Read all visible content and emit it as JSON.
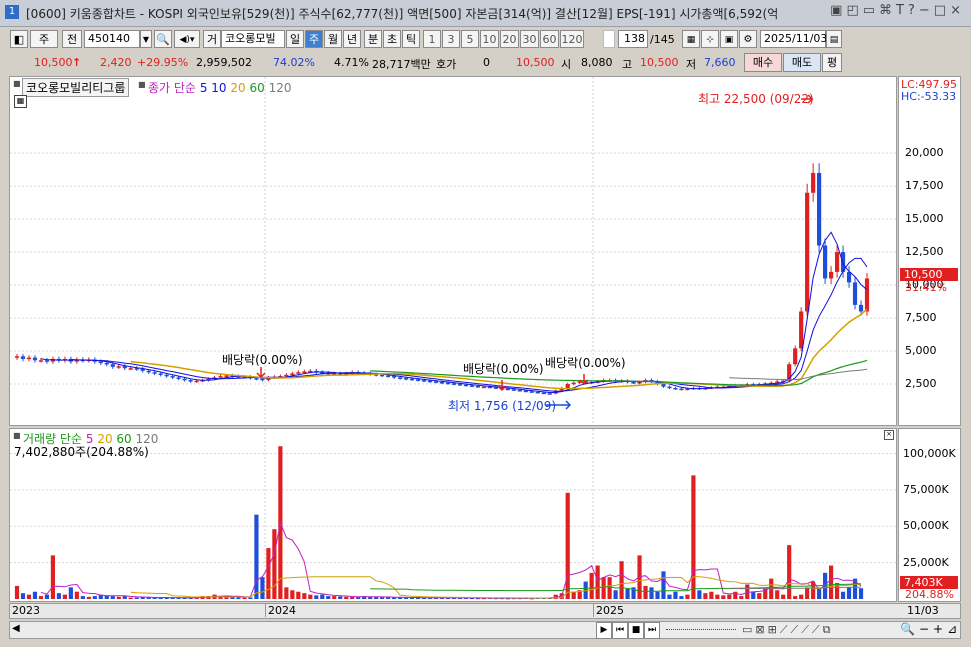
{
  "titlebar": {
    "app_num": "1",
    "title": "[0600] 키움종합차트 - KOSPI 외국인보유[529(천)] 주식수[62,777(천)] 액면[500] 자본금[314(억)] 결산[12월] EPS[-191] 시가총액[6,592(억"
  },
  "toolbar": {
    "market": "주",
    "prev": "전",
    "code": "450140",
    "search_icon": "search-icon",
    "sound_icon": "speaker-icon",
    "georae": "거",
    "name": "코오롱모빌",
    "periods": [
      "일",
      "주",
      "월",
      "년",
      "분",
      "초",
      "틱"
    ],
    "selected_period": "주",
    "numbers": [
      "1",
      "3",
      "5",
      "10",
      "20",
      "30",
      "60",
      "120"
    ],
    "count": "138",
    "total": "/145",
    "date": "2025/11/03"
  },
  "infobar": {
    "price": "10,500",
    "arrow": "↑",
    "change": "2,420",
    "change_pct": "+29.95%",
    "volume": "2,959,502",
    "vol_pct": "74.02%",
    "turnover": "4.71%",
    "amount": "28,717백만",
    "hoga_label": "호가",
    "hoga_val": "0",
    "hoga_price": "10,500",
    "open_label": "시",
    "open": "8,080",
    "high_label": "고",
    "high": "10,500",
    "low_label": "저",
    "low": "7,660",
    "buy": "매수",
    "sell": "매도",
    "pyeong": "평"
  },
  "price_panel": {
    "stock_tab": "코오롱모빌리티그룹",
    "legend_prefix": "종가 단순",
    "ma_periods": [
      "5",
      "10",
      "20",
      "60",
      "120"
    ],
    "ma_colors": [
      "#1010e0",
      "#1010e0",
      "#d4a000",
      "#1a9a1a",
      "#7a7a7a"
    ],
    "annotations": {
      "high": "최고 22,500 (09/22)",
      "low": "최저 1,756 (12/09)",
      "div1": "배당락(0.00%)",
      "div2": "배당락(0.00%)",
      "div3": "배당락(0.00%)"
    },
    "lc": "LC:497.95",
    "hc": "HC:-53.33",
    "y_ticks": [
      "20,000",
      "17,500",
      "15,000",
      "12,500",
      "10,000",
      "7,500",
      "5,000",
      "2,500"
    ],
    "y_tick_values": [
      20000,
      17500,
      15000,
      12500,
      10000,
      7500,
      5000,
      2500
    ],
    "current_label": "10,500",
    "current_pct": "31.41%"
  },
  "volume_panel": {
    "legend_prefix": "거래량 단순",
    "ma_periods": [
      "5",
      "20",
      "60",
      "120"
    ],
    "current_volume": "7,402,880주(204.88%)",
    "y_ticks": [
      "100,000K",
      "75,000K",
      "50,000K",
      "25,000K"
    ],
    "y_tick_values": [
      100000,
      75000,
      50000,
      25000
    ],
    "current_label": "7,403K",
    "current_pct": "204.88%"
  },
  "x_axis": {
    "labels": [
      "2023",
      "2024",
      "2025",
      "11/03"
    ]
  },
  "chart_data": {
    "type": "candlestick",
    "interval": "weekly",
    "y_range_price": [
      0,
      23500
    ],
    "y_range_volume": [
      0,
      110000
    ],
    "annotated_high": 22500,
    "annotated_low": 1756,
    "closes": [
      4600,
      4400,
      4500,
      4300,
      4300,
      4200,
      4400,
      4300,
      4400,
      4200,
      4350,
      4300,
      4350,
      4200,
      4100,
      4000,
      3800,
      3850,
      3700,
      3700,
      3650,
      3500,
      3400,
      3300,
      3200,
      3100,
      3000,
      2900,
      2800,
      2700,
      2750,
      2800,
      2900,
      3000,
      3100,
      3150,
      3100,
      3050,
      3050,
      2950,
      2900,
      2800,
      3000,
      3050,
      3100,
      3200,
      3300,
      3400,
      3450,
      3500,
      3400,
      3350,
      3300,
      3300,
      3250,
      3300,
      3400,
      3350,
      3300,
      3250,
      3200,
      3150,
      3100,
      3000,
      2950,
      2900,
      2850,
      2800,
      2750,
      2700,
      2650,
      2600,
      2550,
      2500,
      2450,
      2400,
      2350,
      2300,
      2300,
      2250,
      2200,
      2150,
      2100,
      2050,
      2000,
      1950,
      1900,
      1850,
      1800,
      1780,
      2000,
      2200,
      2500,
      2600,
      2700,
      2600,
      2650,
      2700,
      2800,
      2800,
      2700,
      2750,
      2650,
      2600,
      2650,
      2800,
      2700,
      2500,
      2300,
      2200,
      2150,
      2100,
      2150,
      2200,
      2150,
      2200,
      2250,
      2300,
      2300,
      2350,
      2400,
      2400,
      2500,
      2450,
      2500,
      2550,
      2600,
      2700,
      2750,
      4000,
      5200,
      8000,
      17000,
      18500,
      13000,
      10500,
      11000,
      12500,
      11000,
      10200,
      8500,
      8000,
      10500
    ],
    "volumes_k": [
      9000,
      4000,
      3000,
      5000,
      2000,
      3000,
      30000,
      4000,
      3000,
      8000,
      5000,
      2000,
      1500,
      2000,
      3000,
      2500,
      2000,
      1500,
      2000,
      1000,
      1000,
      1500,
      1000,
      800,
      800,
      1000,
      1200,
      900,
      800,
      700,
      1000,
      2000,
      2000,
      3000,
      1500,
      2000,
      1200,
      1500,
      1500,
      1000,
      58000,
      15000,
      35000,
      48000,
      105000,
      8000,
      6000,
      5000,
      4000,
      3000,
      2500,
      3000,
      2000,
      2000,
      1800,
      1500,
      1400,
      1300,
      2000,
      1500,
      1300,
      1200,
      1200,
      1000,
      1100,
      1000,
      900,
      1000,
      800,
      900,
      1000,
      800,
      700,
      800,
      700,
      900,
      700,
      600,
      600,
      700,
      600,
      600,
      500,
      600,
      600,
      700,
      500,
      900,
      700,
      1000,
      3000,
      4000,
      73000,
      5000,
      6000,
      12000,
      18000,
      23000,
      15000,
      15000,
      6000,
      26000,
      7000,
      8000,
      30000,
      9000,
      8000,
      5000,
      19000,
      3000,
      5000,
      2000,
      3000,
      85000,
      6000,
      4000,
      5000,
      3000,
      2500,
      3000,
      5000,
      2000,
      10000,
      5000,
      4000,
      8000,
      14000,
      6000,
      3000,
      37000,
      2000,
      3000,
      8000,
      12000,
      7000,
      18000,
      23000,
      11000,
      5000,
      8000,
      14000,
      7403
    ]
  }
}
